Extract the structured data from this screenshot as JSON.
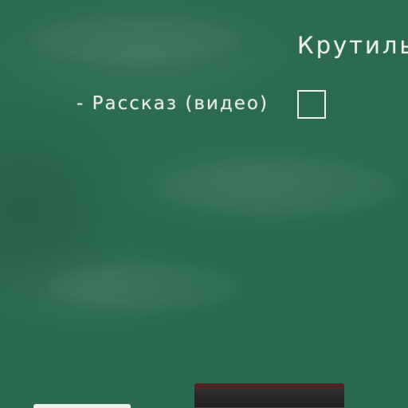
{
  "board": {
    "title": "Крутилы",
    "items": [
      {
        "label": "- Рассказ (видео)",
        "checked": false
      }
    ]
  },
  "colors": {
    "board": "#2b6a51",
    "chalk": "#e8eee8"
  },
  "icons": {
    "eraser": "chalkboard-eraser",
    "chalk": "chalk-stick"
  }
}
